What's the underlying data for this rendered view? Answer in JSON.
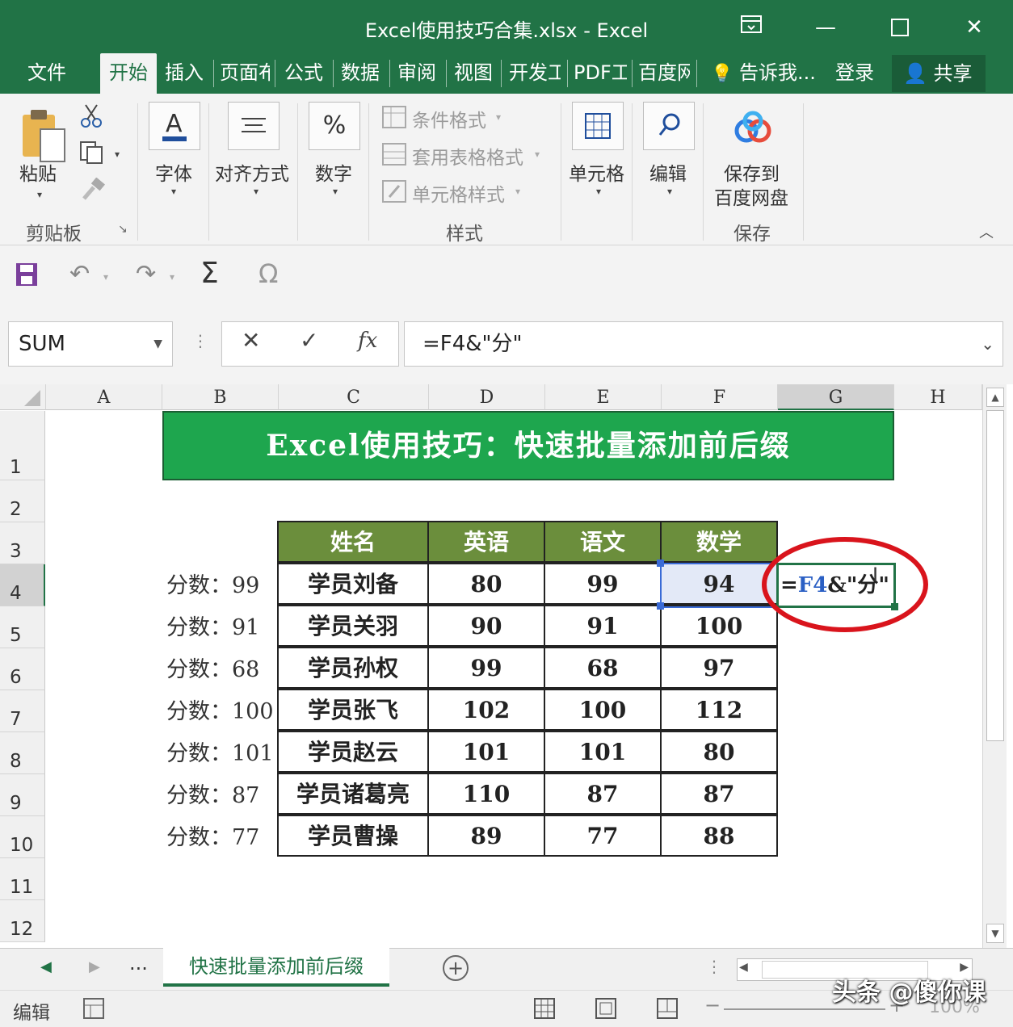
{
  "window": {
    "title": "Excel使用技巧合集.xlsx  -  Excel"
  },
  "ribbon_tabs": [
    "文件",
    "开始",
    "插入",
    "页面布",
    "公式",
    "数据",
    "审阅",
    "视图",
    "开发工",
    "PDF工",
    "百度网"
  ],
  "tell_me": "告诉我...",
  "login": "登录",
  "share": "共享",
  "ribbon": {
    "paste": "粘贴",
    "clipboard": "剪贴板",
    "font": "字体",
    "align": "对齐方式",
    "number": "数字",
    "cond_format": "条件格式",
    "table_format": "套用表格格式",
    "cell_style": "单元格样式",
    "styles": "样式",
    "cells": "单元格",
    "edit": "编辑",
    "save_baidu_1": "保存到",
    "save_baidu_2": "百度网盘",
    "save_group": "保存"
  },
  "formula_bar": {
    "name_box": "SUM",
    "formula": "=F4&\"分\""
  },
  "columns": [
    "A",
    "B",
    "C",
    "D",
    "E",
    "F",
    "G",
    "H"
  ],
  "rows": [
    "1",
    "2",
    "3",
    "4",
    "5",
    "6",
    "7",
    "8",
    "9",
    "10",
    "11",
    "12"
  ],
  "sheet": {
    "banner": "Excel使用技巧：快速批量添加前后缀",
    "headers": [
      "姓名",
      "英语",
      "语文",
      "数学"
    ],
    "data": [
      {
        "label": "分数：99",
        "name": "学员刘备",
        "en": "80",
        "cn": "99",
        "math": "94"
      },
      {
        "label": "分数：91",
        "name": "学员关羽",
        "en": "90",
        "cn": "91",
        "math": "100"
      },
      {
        "label": "分数：68",
        "name": "学员孙权",
        "en": "99",
        "cn": "68",
        "math": "97"
      },
      {
        "label": "分数：100",
        "name": "学员张飞",
        "en": "102",
        "cn": "100",
        "math": "112"
      },
      {
        "label": "分数：101",
        "name": "学员赵云",
        "en": "101",
        "cn": "101",
        "math": "80"
      },
      {
        "label": "分数：87",
        "name": "学员诸葛亮",
        "en": "110",
        "cn": "87",
        "math": "87"
      },
      {
        "label": "分数：77",
        "name": "学员曹操",
        "en": "89",
        "cn": "77",
        "math": "88"
      }
    ],
    "edit_cell": {
      "eq": "=",
      "ref": "F4",
      "rest": "&\"分\""
    }
  },
  "sheet_tab": "快速批量添加前后缀",
  "sheet_nav_more": "...",
  "status": {
    "mode": "编辑",
    "zoom": "100%"
  },
  "watermark": "头条 @傻你课",
  "colors": {
    "excel_green": "#217346",
    "banner_green": "#1ea64e",
    "header_olive": "#6b8e3c",
    "circle_red": "#d9141c"
  }
}
